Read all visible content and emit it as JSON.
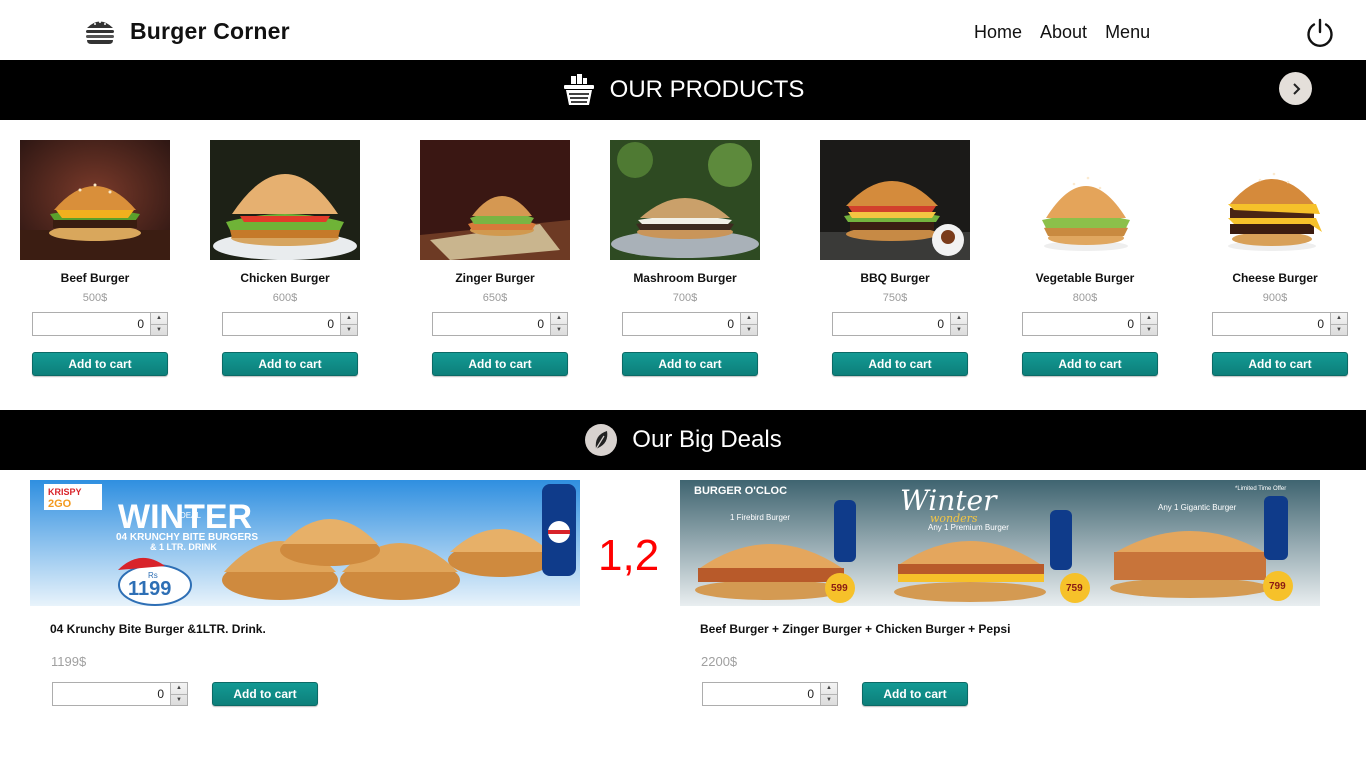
{
  "header": {
    "brand_name": "Burger Corner",
    "brand_icon": "burger-icon",
    "nav": [
      "Home",
      "About",
      "Menu"
    ],
    "power_icon": "power-icon"
  },
  "products_section": {
    "title": "OUR PRODUCTS",
    "icon": "basket-icon",
    "next_icon": "chevron-right-icon",
    "add_label": "Add to cart",
    "items": [
      {
        "name": "Beef Burger",
        "price": "500$",
        "qty": "0"
      },
      {
        "name": "Chicken Burger",
        "price": "600$",
        "qty": "0"
      },
      {
        "name": "Zinger Burger",
        "price": "650$",
        "qty": "0"
      },
      {
        "name": "Mashroom Burger",
        "price": "700$",
        "qty": "0"
      },
      {
        "name": "BBQ Burger",
        "price": "750$",
        "qty": "0"
      },
      {
        "name": "Vegetable Burger",
        "price": "800$",
        "qty": "0"
      },
      {
        "name": "Cheese Burger",
        "price": "900$",
        "qty": "0"
      }
    ]
  },
  "deals_section": {
    "title": "Our Big Deals",
    "icon": "leaf-icon",
    "marker": "1,2",
    "add_label": "Add to cart",
    "items": [
      {
        "title": "04 Krunchy Bite Burger &1LTR. Drink.",
        "price": "1199$",
        "qty": "0",
        "poster": {
          "logo_line1": "KRISPY",
          "logo_line2": "2GO",
          "headline": "WINTER",
          "tag": "DEAL",
          "sub1": "04 KRUNCHY BITE BURGERS",
          "sub2": "& 1 LTR. DRINK",
          "badge_rs": "Rs",
          "badge_price": "1199"
        }
      },
      {
        "title": "Beef Burger + Zinger Burger + Chicken Burger + Pepsi",
        "price": "2200$",
        "qty": "0",
        "poster": {
          "brand": "BURGER O'CLOC",
          "headline": "Winter",
          "sub": "wonders",
          "offer": "*Limited Time Offer",
          "deal1": "1 Firebird Burger",
          "deal2": "Any 1 Premium Burger",
          "deal3": "Any 1 Gigantic Burger",
          "price1": "599",
          "price2": "759",
          "price3": "799"
        }
      }
    ]
  },
  "colors": {
    "banner": "#000000",
    "button": "#108c86",
    "marker": "#ff0000",
    "price": "#9a9a9a"
  }
}
